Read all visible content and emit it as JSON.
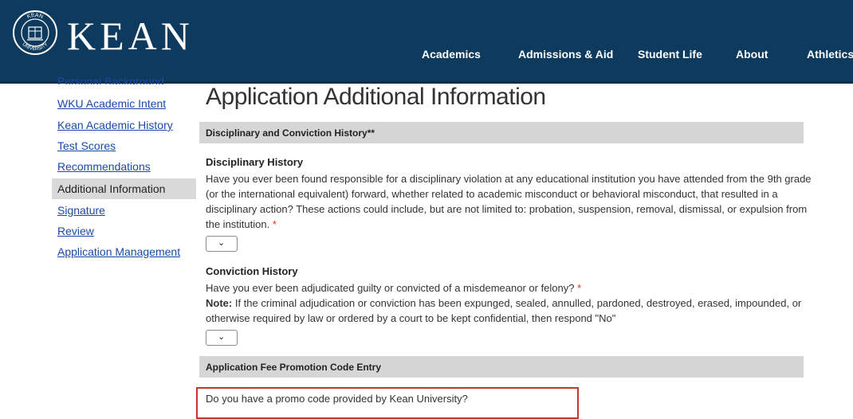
{
  "header": {
    "logo_text": "KEAN",
    "seal_ring_top": "KEAN",
    "seal_ring_bottom": "UNIVERSITY",
    "nav": [
      "Academics",
      "Admissions & Aid",
      "Student Life",
      "About",
      "Athletics"
    ],
    "background": "#0e3a5d"
  },
  "sidebar": {
    "partial_item": "Personal Background",
    "items": [
      {
        "label": "WKU Academic Intent"
      },
      {
        "label": "Kean Academic History"
      },
      {
        "label": "Test Scores"
      },
      {
        "label": "Recommendations"
      },
      {
        "label": "Additional Information"
      },
      {
        "label": "Signature"
      },
      {
        "label": "Review"
      },
      {
        "label": "Application Management"
      }
    ]
  },
  "main": {
    "title": "Application Additional Information",
    "section1": "Disciplinary and Conviction History**",
    "disciplinary": {
      "heading": "Disciplinary History",
      "text": "Have you ever been found responsible for a disciplinary violation at any educational institution you have attended from the 9th grade (or the international equivalent) forward, whether related to academic misconduct or behavioral misconduct, that resulted in a disciplinary action? These actions could include, but are not limited to: probation, suspension, removal, dismissal, or expulsion from the institution.",
      "required_mark": "*",
      "value": ""
    },
    "conviction": {
      "heading": "Conviction History",
      "text": "Have you ever been adjudicated guilty or convicted of a misdemeanor or felony?",
      "required_mark": "*",
      "note_label": "Note:",
      "note_text": "If the criminal adjudication or conviction has been expunged, sealed, annulled, pardoned, destroyed, erased, impounded, or otherwise required by law or ordered by a court to be kept confidential, then respond \"No\"",
      "value": ""
    },
    "section2": "Application Fee Promotion Code Entry",
    "promo": {
      "question": "Do you have a promo code provided by Kean University?"
    }
  },
  "colors": {
    "header": "#0e3a5d",
    "link": "#1a4aa8",
    "required": "#d32f2f",
    "highlight_border": "#c0392b",
    "section_bar": "#d6d6d6"
  }
}
